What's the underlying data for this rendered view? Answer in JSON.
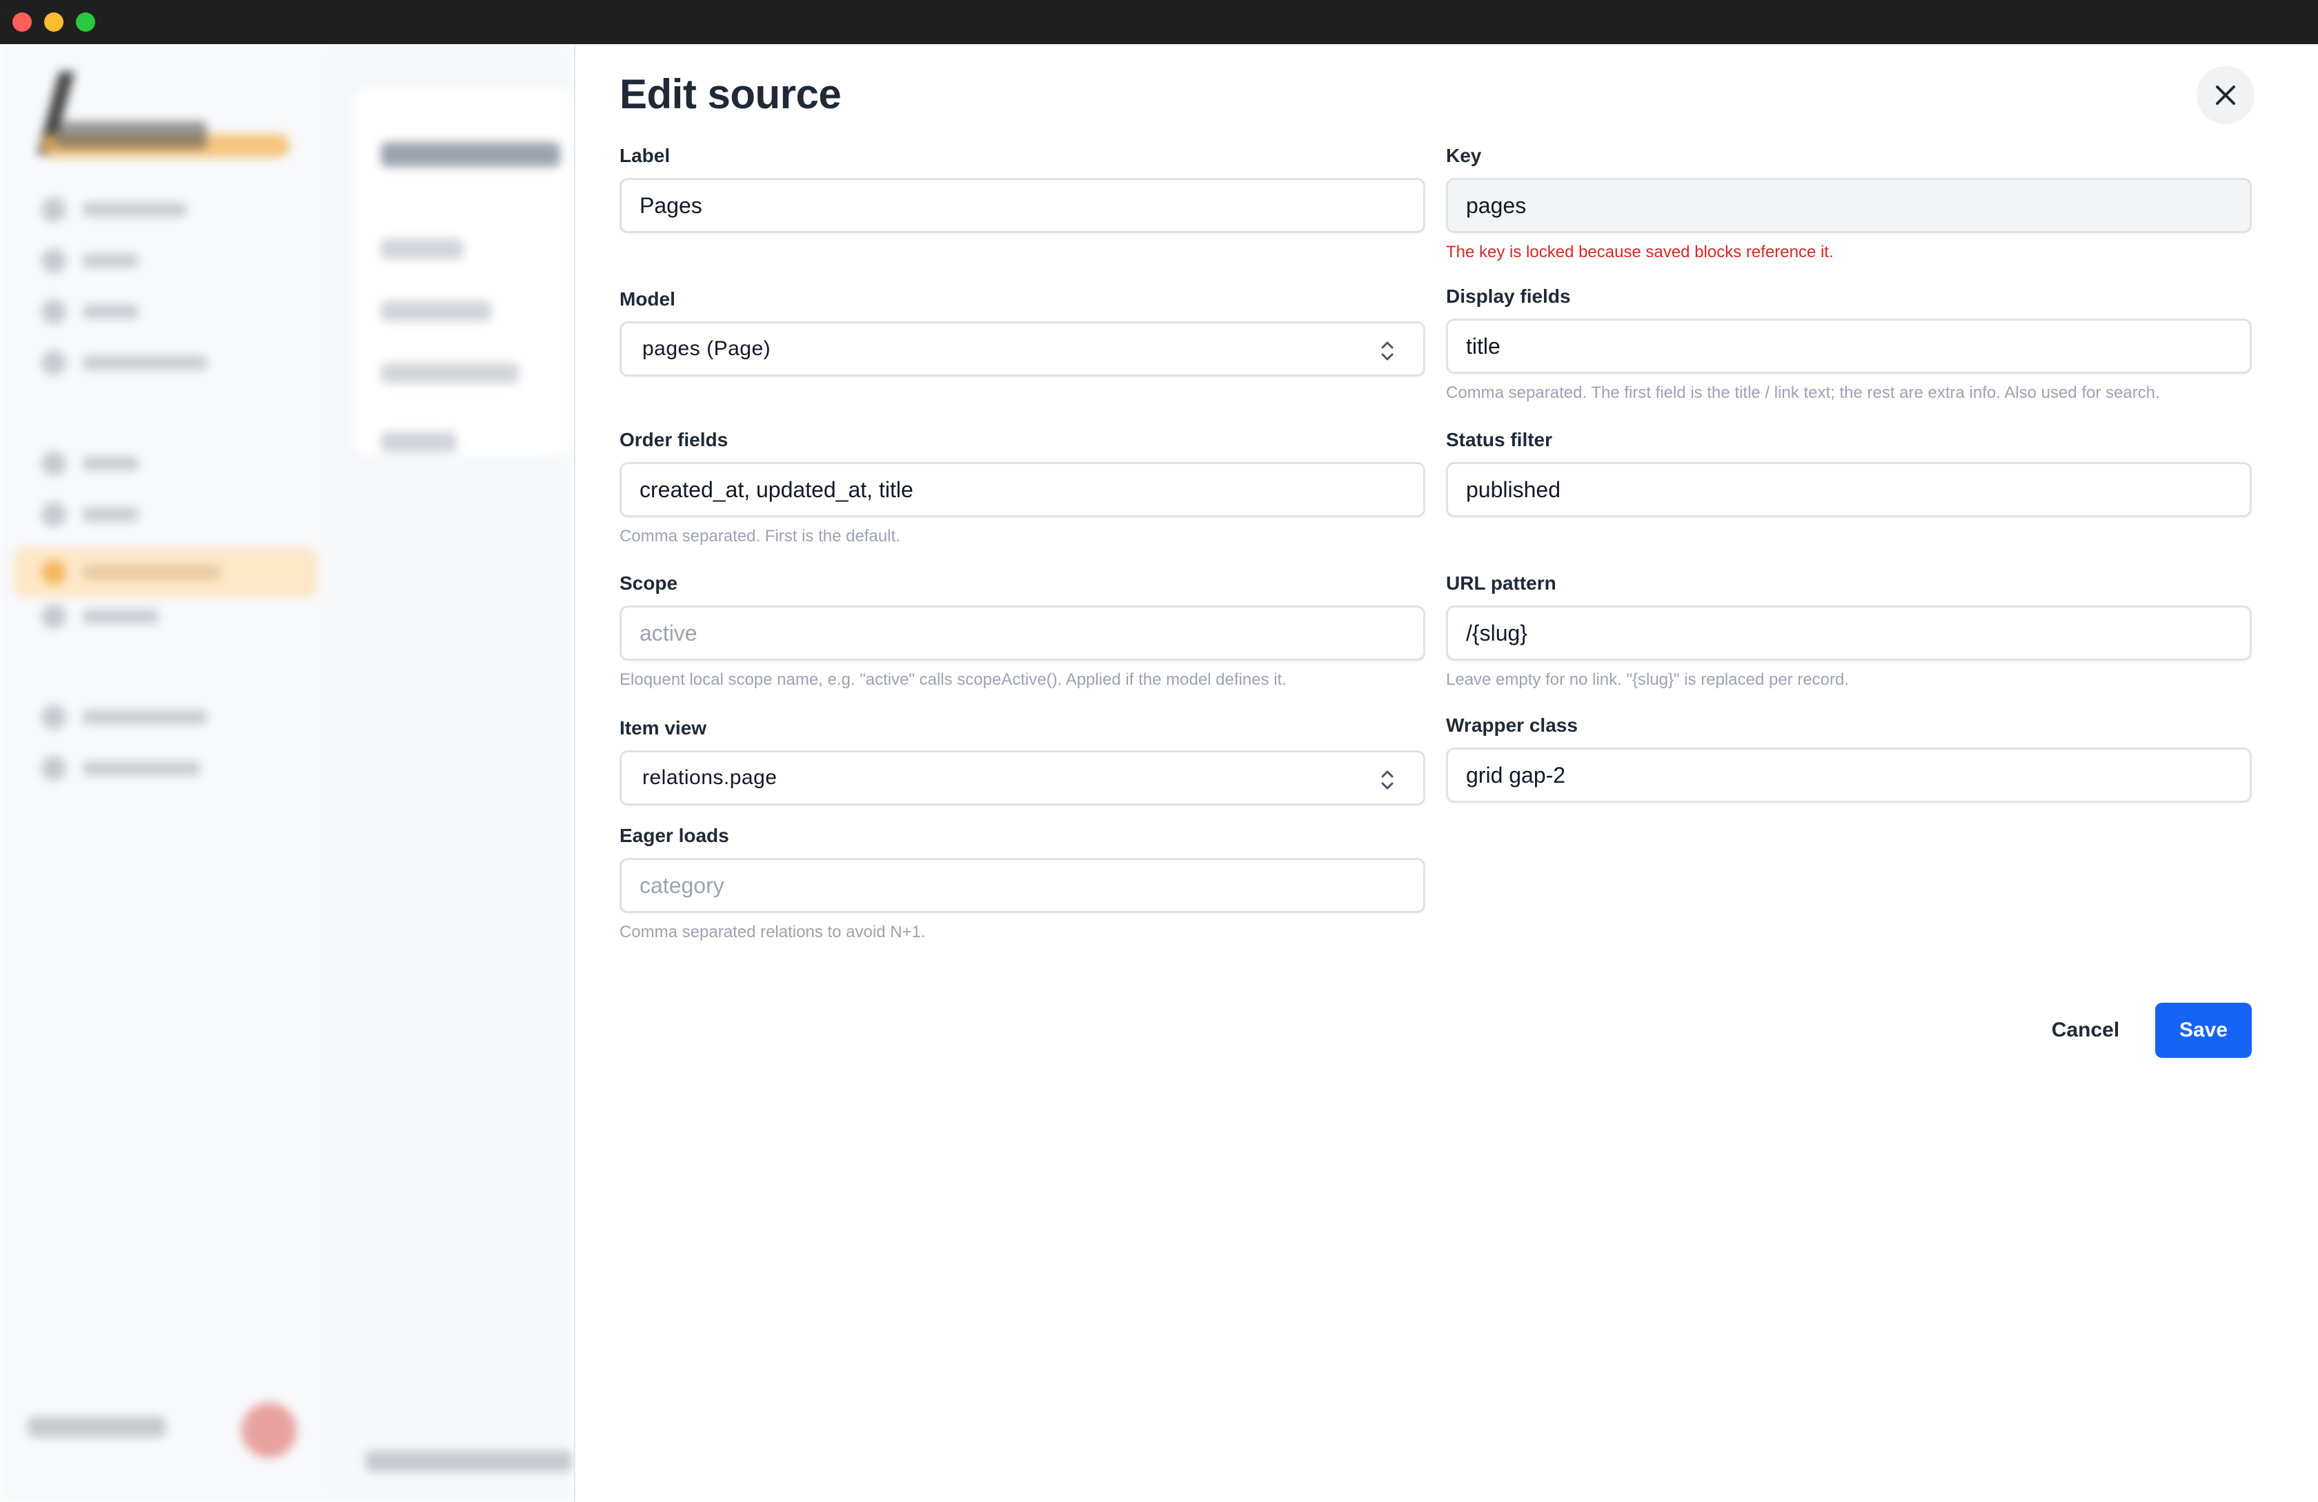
{
  "drawer": {
    "title": "Edit source",
    "fields": {
      "label": {
        "label": "Label",
        "value": "Pages"
      },
      "key": {
        "label": "Key",
        "value": "pages",
        "error": "The key is locked because saved blocks reference it."
      },
      "model": {
        "label": "Model",
        "value": "pages (Page)"
      },
      "display_fields": {
        "label": "Display fields",
        "value": "title",
        "hint": "Comma separated. The first field is the title / link text; the rest are extra info. Also used for search."
      },
      "order_fields": {
        "label": "Order fields",
        "value": "created_at, updated_at, title",
        "hint": "Comma separated. First is the default."
      },
      "status_filter": {
        "label": "Status filter",
        "value": "published"
      },
      "scope": {
        "label": "Scope",
        "placeholder": "active",
        "hint": "Eloquent local scope name, e.g. \"active\" calls scopeActive(). Applied if the model defines it."
      },
      "url_pattern": {
        "label": "URL pattern",
        "value": "/{slug}",
        "hint": "Leave empty for no link. \"{slug}\" is replaced per record."
      },
      "item_view": {
        "label": "Item view",
        "value": "relations.page"
      },
      "wrapper_class": {
        "label": "Wrapper class",
        "value": "grid gap-2"
      },
      "eager_loads": {
        "label": "Eager loads",
        "placeholder": "category",
        "hint": "Comma separated relations to avoid N+1."
      }
    },
    "actions": {
      "cancel": "Cancel",
      "save": "Save"
    }
  },
  "colors": {
    "primary": "#1663f7",
    "error": "#dc2626",
    "active_nav": "#fde7c7"
  },
  "icons": {
    "close": "close-icon",
    "select_chevron": "chevron-up-down-icon"
  }
}
